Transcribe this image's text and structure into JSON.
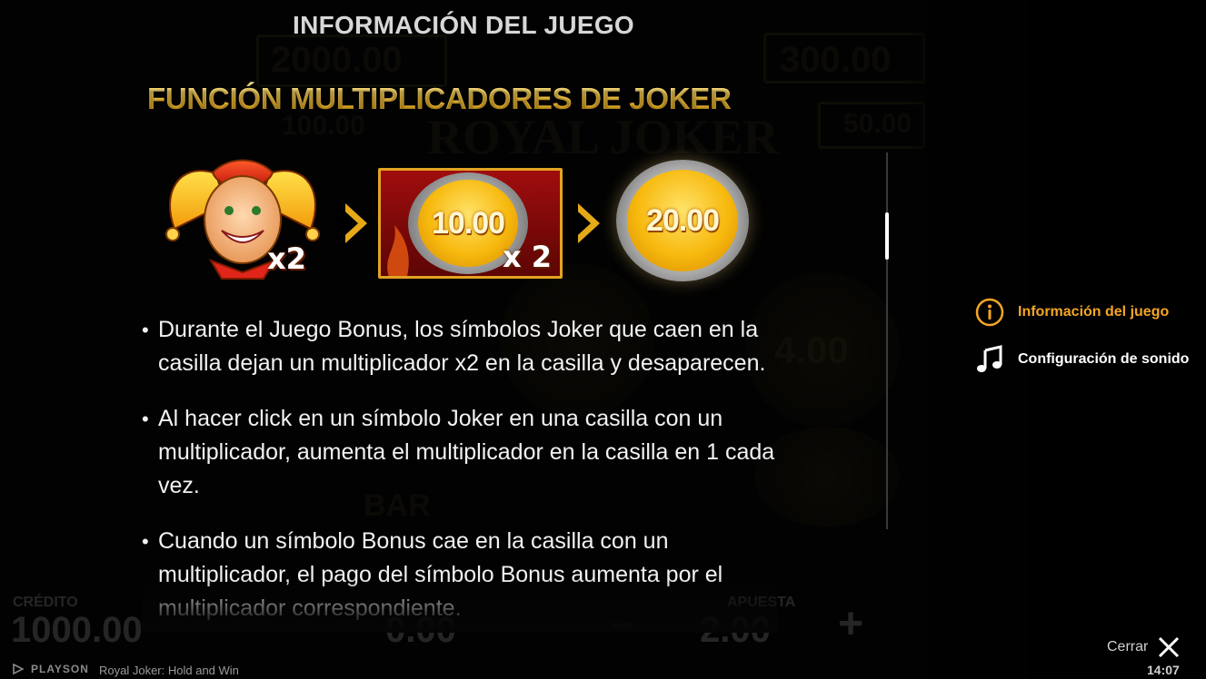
{
  "window": {
    "heading": "INFORMACIÓN DEL JUEGO"
  },
  "section": {
    "title": "FUNCIÓN MULTIPLICADORES DE JOKER"
  },
  "illustration": {
    "joker_multiplier": "x2",
    "tile_coin_value": "10.00",
    "tile_multiplier": "x 2",
    "result_coin_value": "20.00"
  },
  "bullets": [
    {
      "text": "Durante el Juego Bonus, los símbolos Joker que caen en la casilla dejan un multiplicador x2 en la casilla y desaparecen."
    },
    {
      "text": "Al hacer click en un símbolo Joker en una casilla con un multiplicador, aumenta el multiplicador en la casilla en 1 cada vez."
    },
    {
      "text": "Cuando un símbolo Bonus cae en la casilla con un multiplicador, el pago del símbolo Bonus aumenta por el multiplicador correspondiente."
    }
  ],
  "side_menu": {
    "items": [
      {
        "label": "Información del juego",
        "icon": "info-icon",
        "active": true
      },
      {
        "label": "Configuración de sonido",
        "icon": "music-note-icon",
        "active": false
      }
    ]
  },
  "background_game": {
    "grand_value": "2000.00",
    "major_value": "300.00",
    "minor_value": "100.00",
    "mini_value": "50.00",
    "logo_text": "ROYAL JOKER",
    "coin_value": "4.00",
    "bar_label": "BAR",
    "credit_label": "CRÉDITO",
    "credit_value": "1000.00",
    "win_value": "0.00",
    "bet_label": "APUESTA",
    "bet_value": "2.00"
  },
  "footer": {
    "brand": "PLAYSON",
    "game_title": "Royal Joker: Hold and Win",
    "close_label": "Cerrar",
    "clock": "14:07"
  },
  "colors": {
    "accent": "#f5a623",
    "gold_title": "#f1c232",
    "tile_red": "#a00d0d",
    "background": "#050505"
  }
}
